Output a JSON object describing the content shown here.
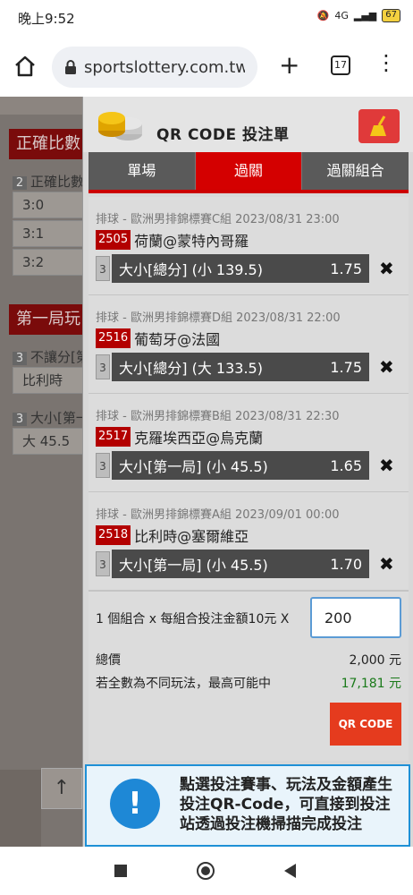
{
  "status_bar": {
    "time": "晚上9:52",
    "network": "4G",
    "battery": "67"
  },
  "browser": {
    "url": "sportslottery.com.tw/",
    "tab_count": "17"
  },
  "background_page": {
    "section1": {
      "title": "正確比數",
      "sub_num": "2",
      "sub_label": "正確比數",
      "cells": [
        "3:0",
        "3:1",
        "3:2"
      ]
    },
    "section2": {
      "title": "第一局玩",
      "sub1_num": "3",
      "sub1_label": "不讓分[第",
      "sub1_cell": "比利時",
      "sub2_num": "3",
      "sub2_label": "大小[第一",
      "sub2_cell": "大 45.5"
    },
    "scroll_top": "↑"
  },
  "slip": {
    "title": "QR CODE 投注單",
    "tabs": [
      {
        "label": "單場",
        "active": false
      },
      {
        "label": "過關",
        "active": true
      },
      {
        "label": "過關組合",
        "active": false
      }
    ],
    "bets": [
      {
        "league": "排球 - 歐洲男排錦標賽C組 2023/08/31 23:00",
        "code": "2505",
        "match": "荷蘭@蒙特內哥羅",
        "num": "3",
        "selection": "大小[總分] (小 139.5)",
        "odds": "1.75"
      },
      {
        "league": "排球 - 歐洲男排錦標賽D組 2023/08/31 22:00",
        "code": "2516",
        "match": "葡萄牙@法國",
        "num": "3",
        "selection": "大小[總分] (大 133.5)",
        "odds": "1.75"
      },
      {
        "league": "排球 - 歐洲男排錦標賽B組 2023/08/31 22:30",
        "code": "2517",
        "match": "克羅埃西亞@烏克蘭",
        "num": "3",
        "selection": "大小[第一局] (小 45.5)",
        "odds": "1.65"
      },
      {
        "league": "排球 - 歐洲男排錦標賽A組 2023/09/01 00:00",
        "code": "2518",
        "match": "比利時@塞爾維亞",
        "num": "3",
        "selection": "大小[第一局] (小 45.5)",
        "odds": "1.70"
      }
    ],
    "summary": {
      "combo_text": "1 個組合 x 每組合投注金額10元 X",
      "amount": "200",
      "total_label": "總價",
      "total_value": "2,000 元",
      "max_label": "若全數為不同玩法，最高可能中",
      "max_value": "17,181 元",
      "qr_button": "QR CODE"
    },
    "info_text": "點選投注賽事、玩法及金額產生投注QR-Code，可直接到投注站透過投注機掃描完成投注"
  },
  "colors": {
    "accent_red": "#d40000",
    "max_green": "#1a7a1a",
    "info_blue": "#1e88d6"
  }
}
